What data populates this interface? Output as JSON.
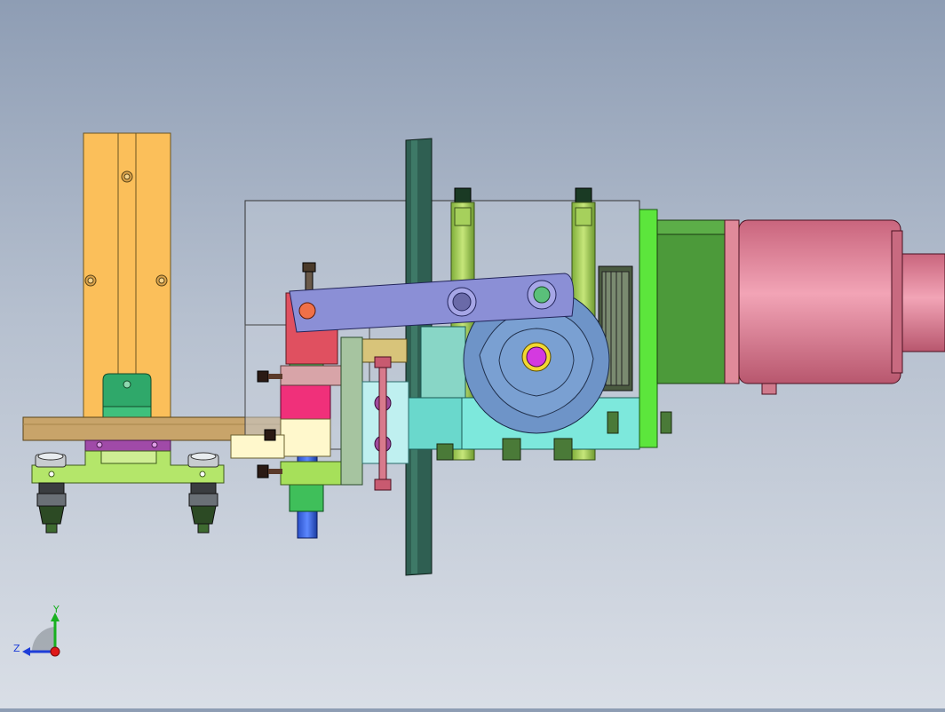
{
  "viewport": {
    "background_top": "#8e9db4",
    "background_bottom": "#d9dee6"
  },
  "triad": {
    "y_label": "Y",
    "z_label": "Z",
    "y_color": "#18b01f",
    "z_color": "#1e3ed8",
    "x_color": "#e01818"
  },
  "colors": {
    "orange_column": "#fbbf5a",
    "tan_bar": "#c8a46a",
    "lime_base": "#b4e66a",
    "green_bracket": "#2fa86a",
    "purple_arm": "#8b8fd6",
    "steel_blue_gear": "#6e94c8",
    "cyan_block": "#7de8dc",
    "pink_motor": "#e0809a",
    "green_motor_body": "#4c9a3a",
    "bright_green_plate": "#5ce63c",
    "dark_disc": "#2f5f52",
    "blue_rod": "#1d5bd8",
    "magenta_block": "#f0307a"
  }
}
